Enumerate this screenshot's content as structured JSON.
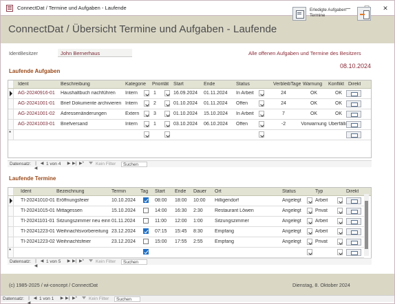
{
  "window": {
    "title": "ConnectDat / Termine und Aufgaben - Laufende",
    "minimize": "─",
    "maximize": "☐",
    "close": "✕"
  },
  "header": {
    "title": "ConnectDat / Übersicht Termine und Aufgaben - Laufende",
    "done_button_label": "Erledigte Aufgaben Termine"
  },
  "owner": {
    "label": "IdentBesitzer",
    "value": "John Bernerhaus"
  },
  "info_text": "Alle offenen Aufgaben und Termine des Besitzers",
  "current_date": "08.10.2024",
  "aufgaben": {
    "section_title": "Laufende Aufgaben",
    "columns": [
      "Ident",
      "Beschreibung",
      "Kategorie",
      "Priorität",
      "Start",
      "Ende",
      "Status",
      "VerbleibTage",
      "Warnung",
      "Konflikt",
      "Direkt"
    ],
    "rows": [
      {
        "ident": "AG-20240916-01",
        "beschreibung": "Haushaltbuch nachführen",
        "kategorie": "Intern",
        "prioritaet": "1",
        "start": "16.09.2024",
        "ende": "01.11.2024",
        "status": "In Arbeit",
        "verbleib": "24",
        "warnung": "OK",
        "konflikt": "OK"
      },
      {
        "ident": "AG-20241001-01",
        "beschreibung": "Brief Dokumente archivieren",
        "kategorie": "Intern",
        "prioritaet": "2",
        "start": "01.10.2024",
        "ende": "01.11.2024",
        "status": "Offen",
        "verbleib": "24",
        "warnung": "OK",
        "konflikt": "OK"
      },
      {
        "ident": "AG-20241001-02",
        "beschreibung": "Adressenänderungen",
        "kategorie": "Extern",
        "prioritaet": "3",
        "start": "01.10.2024",
        "ende": "15.10.2024",
        "status": "In Arbeit",
        "verbleib": "7",
        "warnung": "OK",
        "konflikt": "OK"
      },
      {
        "ident": "AG-20241003-01",
        "beschreibung": "Briefversand",
        "kategorie": "Intern",
        "prioritaet": "1",
        "start": "03.10.2024",
        "ende": "06.10.2024",
        "status": "Offen",
        "verbleib": "-2",
        "warnung": "Vorwarnung",
        "konflikt": "Überfällig"
      }
    ],
    "nav": {
      "label": "Datensatz:",
      "position": "1 von 4",
      "filter": "Kein Filter",
      "search": "Suchen"
    }
  },
  "termine": {
    "section_title": "Laufende Termine",
    "columns": [
      "Ident",
      "Bezeichnung",
      "Termin",
      "Tag",
      "Start",
      "Ende",
      "Dauer",
      "Ort",
      "Status",
      "Typ",
      "Direkt"
    ],
    "rows": [
      {
        "ident": "TI-20241010-01",
        "bezeichnung": "Eröffnungsfeier",
        "termin": "10.10.2024",
        "tag": true,
        "start": "08:00",
        "ende": "18:00",
        "dauer": "10:00",
        "ort": "Hilligendorf",
        "status": "Angelegt",
        "typ": "Arbeit"
      },
      {
        "ident": "TI-20241015-01",
        "bezeichnung": "Mittagessen",
        "termin": "15.10.2024",
        "tag": false,
        "start": "14:00",
        "ende": "16:30",
        "dauer": "2:30",
        "ort": "Restaurant Löwen",
        "status": "Angelegt",
        "typ": "Privat"
      },
      {
        "ident": "TI-20241101-01",
        "bezeichnung": "Sitzungszimmer neu einri",
        "termin": "01.11.2024",
        "tag": false,
        "start": "11:00",
        "ende": "12:00",
        "dauer": "1:00",
        "ort": "Sitzungszimmer",
        "status": "Angelegt",
        "typ": "Arbeit"
      },
      {
        "ident": "TI-20241223-01",
        "bezeichnung": "Weihnachtsvorbereitung",
        "termin": "23.12.2024",
        "tag": true,
        "start": "07:15",
        "ende": "15:45",
        "dauer": "8:30",
        "ort": "Empfang",
        "status": "Angelegt",
        "typ": "Arbeit"
      },
      {
        "ident": "TI-20241223-02",
        "bezeichnung": "Weihnachtsfeier",
        "termin": "23.12.2024",
        "tag": false,
        "start": "15:00",
        "ende": "17:55",
        "dauer": "2:55",
        "ort": "Empfang",
        "status": "Angelegt",
        "typ": "Privat"
      }
    ],
    "nav": {
      "label": "Datensatz:",
      "position": "1 von 5",
      "filter": "Kein Filter",
      "search": "Suchen"
    }
  },
  "footer": {
    "copyright": "(c) 1985-2025 / wi-concept / ConnectDat",
    "today": "Dienstag, 8. Oktober 2024"
  },
  "main_nav": {
    "label": "Datensatz:",
    "position": "1 von 1",
    "filter": "Kein Filter",
    "search": "Suchen"
  },
  "nav_glyphs": {
    "first": "|◀",
    "prev": "◀",
    "next": "▶",
    "last": "▶|",
    "new": "▶*"
  },
  "icons": {
    "done_tasks_button": "calendar-list-icon",
    "exit_button": "exit-door-icon",
    "direct_open": "form-open-icon",
    "filter": "funnel-icon"
  },
  "colors": {
    "header_bg": "#dad7c5",
    "title_accent": "#8a2a36",
    "section_title": "#9a4a1a",
    "grid_header": "#e3e3d4",
    "checkbox_on": "#1f6fc5"
  }
}
